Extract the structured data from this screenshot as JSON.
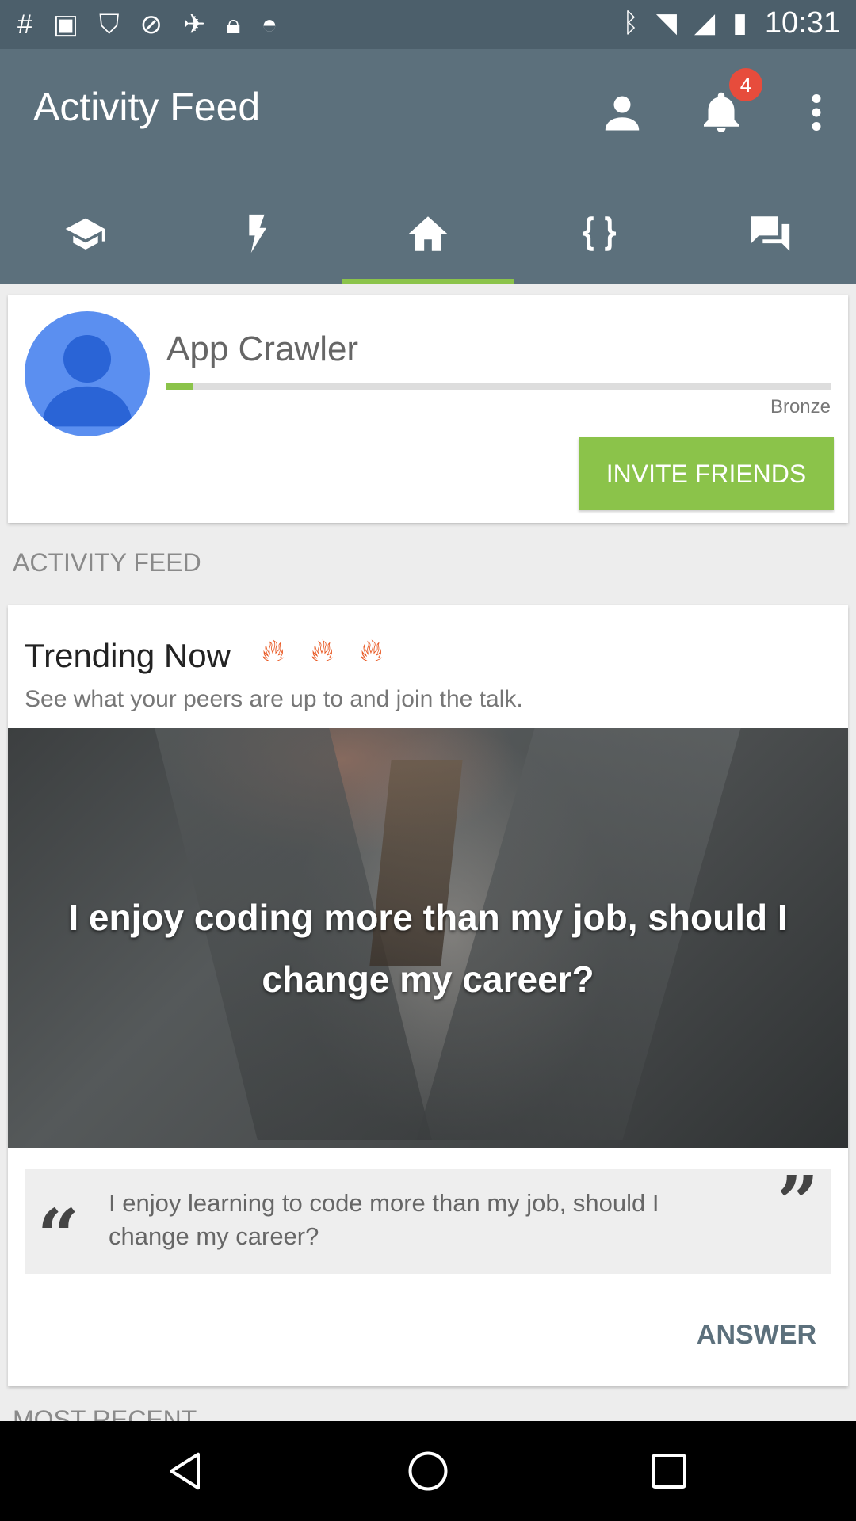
{
  "status_bar": {
    "time": "10:31",
    "icons": [
      "slack-icon",
      "photo-icon",
      "shield-icon",
      "blocked-icon",
      "satellite-fake-icon",
      "lock-icon",
      "android-icon",
      "bluetooth-icon",
      "wifi-icon",
      "signal-icon",
      "battery-icon"
    ]
  },
  "header": {
    "title": "Activity Feed",
    "notification_count": "4",
    "icons": [
      "person-icon",
      "bell-icon",
      "more-vert-icon"
    ]
  },
  "tabs": [
    {
      "icon": "school-icon",
      "active": false
    },
    {
      "icon": "flash-icon",
      "active": false
    },
    {
      "icon": "home-icon",
      "active": true
    },
    {
      "icon": "braces-icon",
      "active": false
    },
    {
      "icon": "chat-icon",
      "active": false
    }
  ],
  "profile": {
    "name": "App Crawler",
    "rank": "Bronze",
    "progress": 0.04,
    "invite_label": "INVITE FRIENDS"
  },
  "activity_feed_label": "ACTIVITY FEED",
  "trending": {
    "title": "Trending Now",
    "fire_icons": [
      "fire-icon",
      "fire-icon",
      "fire-icon"
    ],
    "subtitle": "See what your peers are up to and join the talk.",
    "image_caption": "I enjoy coding more than my job, should I change my career?",
    "quote": "I enjoy learning to code more than my job, should I change my career?",
    "answer_label": "ANSWER"
  },
  "most_recent_label": "MOST RECENT",
  "colors": {
    "header": "#5c707c",
    "accent": "#8bc34a",
    "badge": "#e74c3c",
    "avatar": "#5b8ff0"
  }
}
